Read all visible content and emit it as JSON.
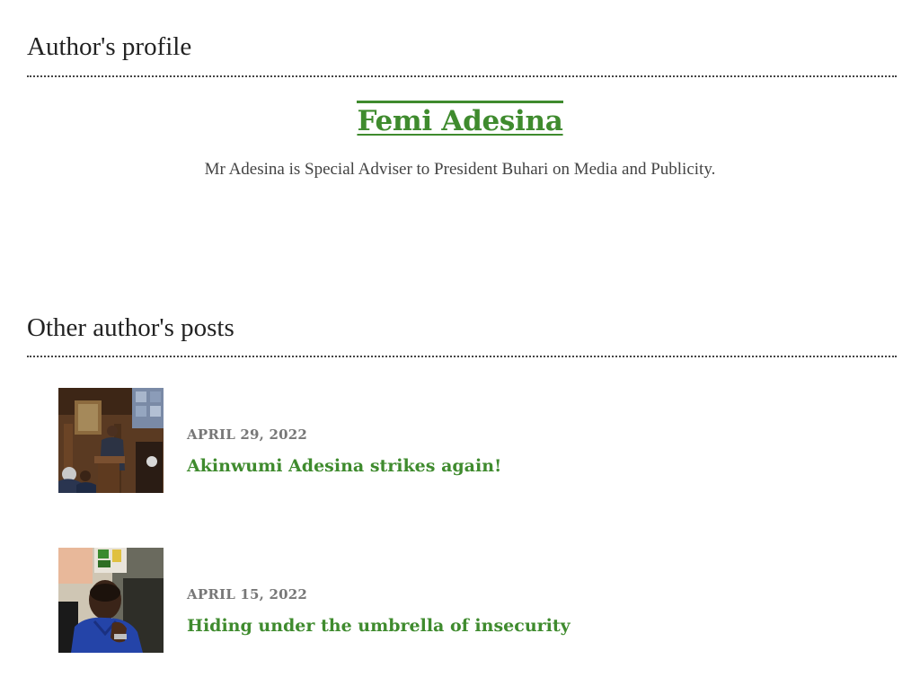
{
  "profile_section": {
    "heading": "Author's profile",
    "author_name": "Femi Adesina",
    "author_bio": "Mr Adesina is Special Adviser to President Buhari on Media and Publicity."
  },
  "posts_section": {
    "heading": "Other author's posts",
    "posts": [
      {
        "date": "APRIL 29, 2022",
        "title": "Akinwumi Adesina strikes again!",
        "thumbnail": "speaker-at-podium-photo"
      },
      {
        "date": "APRIL 15, 2022",
        "title": "Hiding under the umbrella of insecurity",
        "thumbnail": "man-in-blue-shirt-photo"
      }
    ]
  },
  "colors": {
    "accent_green": "#3f8b2e",
    "date_gray": "#777777",
    "text_dark": "#222222"
  }
}
